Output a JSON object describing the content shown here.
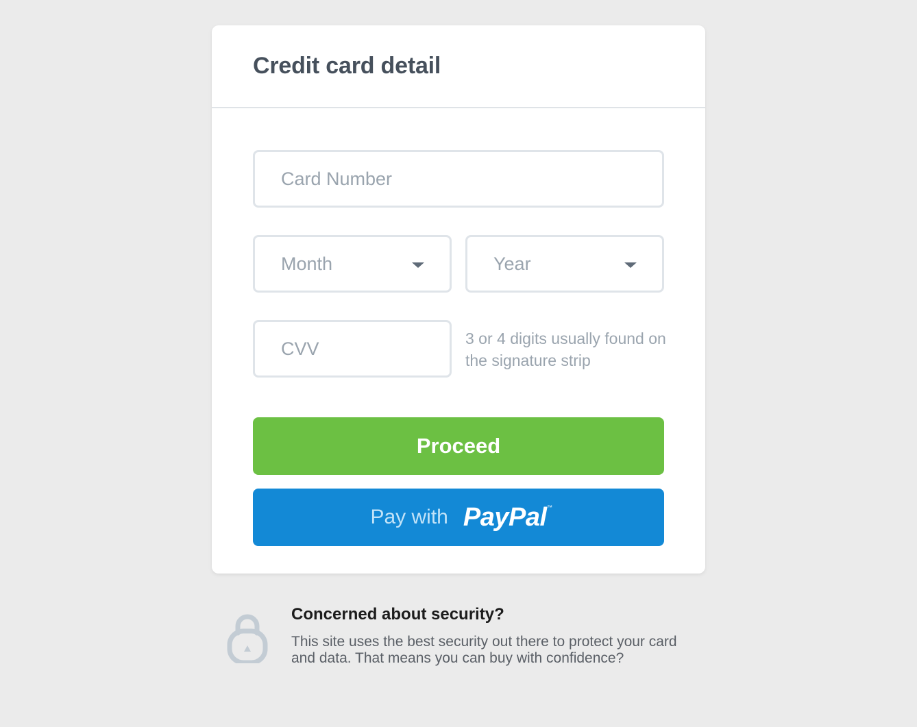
{
  "card": {
    "title": "Credit card detail"
  },
  "form": {
    "card_number_placeholder": "Card Number",
    "month_label": "Month",
    "year_label": "Year",
    "cvv_placeholder": "CVV",
    "cvv_hint": "3 or 4 digits usually found on the signature strip",
    "proceed_label": "Proceed",
    "paypal_prefix": "Pay with",
    "paypal_logo": "PayPal",
    "paypal_tm": "™"
  },
  "security": {
    "icon": "lock-icon",
    "title": "Concerned about security?",
    "text": "This site uses the best security out there to protect your card and data. That means you can buy with confidence?"
  },
  "colors": {
    "background": "#ebebeb",
    "proceed": "#6cc043",
    "paypal": "#1389d6",
    "title": "#46505c",
    "placeholder": "#9aa4ae"
  }
}
